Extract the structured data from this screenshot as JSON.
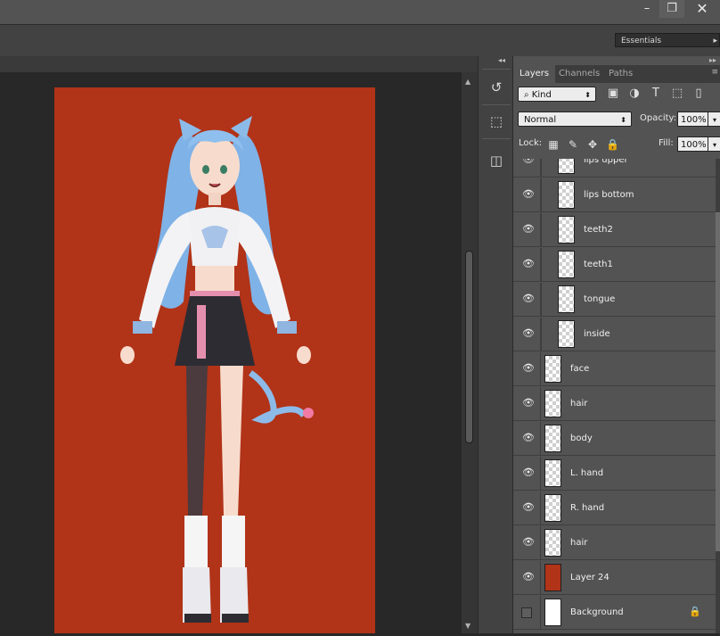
{
  "window": {
    "controls": {
      "minimize": "–",
      "maximize": "❐",
      "close": "✕"
    }
  },
  "options_bar": {
    "workspace": "Essentials",
    "workspace_arrow": "▸"
  },
  "colors": {
    "canvas_background": "#b13318",
    "layer24_swatch": "#b13318"
  },
  "icon_strip": {
    "collapse_glyph": "◂◂",
    "tools": [
      {
        "icon": "history-icon",
        "glyph": "↺"
      },
      {
        "icon": "3d-cube-icon",
        "glyph": "⬚"
      },
      {
        "icon": "layer-comps-icon",
        "glyph": "◫"
      }
    ]
  },
  "layers_panel": {
    "expand_glyph": "▸▸",
    "tabs": [
      {
        "label": "Layers",
        "active": true
      },
      {
        "label": "Channels",
        "active": false
      },
      {
        "label": "Paths",
        "active": false
      }
    ],
    "tab_menu_glyph": "≡",
    "filter": {
      "kind_label": "Kind",
      "search_glyph": "⌕",
      "arrows_glyph": "⬍",
      "icons": [
        {
          "icon": "image-filter-icon",
          "glyph": "▣"
        },
        {
          "icon": "adjustment-filter-icon",
          "glyph": "◑"
        },
        {
          "icon": "type-filter-icon",
          "glyph": "T"
        },
        {
          "icon": "shape-filter-icon",
          "glyph": "⬚"
        },
        {
          "icon": "smart-object-filter-icon",
          "glyph": "▯"
        }
      ]
    },
    "blend": {
      "mode": "Normal",
      "arrows_glyph": "⬍",
      "opacity_label": "Opacity:",
      "opacity_value": "100%",
      "dd_glyph": "▾"
    },
    "lock": {
      "label": "Lock:",
      "icons": [
        {
          "icon": "lock-transparent-pixels-icon",
          "glyph": "▦"
        },
        {
          "icon": "lock-image-pixels-icon",
          "glyph": "✎"
        },
        {
          "icon": "lock-position-icon",
          "glyph": "✥"
        },
        {
          "icon": "lock-all-icon",
          "glyph": "🔒"
        }
      ],
      "fill_label": "Fill:",
      "fill_value": "100%",
      "dd_glyph": "▾"
    },
    "eye_glyph": "👁",
    "layers": [
      {
        "name": "lips upper",
        "visible": true,
        "indented": true,
        "thumb": "checker"
      },
      {
        "name": "lips bottom",
        "visible": true,
        "indented": true,
        "thumb": "checker"
      },
      {
        "name": "teeth2",
        "visible": true,
        "indented": true,
        "thumb": "checker"
      },
      {
        "name": "teeth1",
        "visible": true,
        "indented": true,
        "thumb": "checker"
      },
      {
        "name": "tongue",
        "visible": true,
        "indented": true,
        "thumb": "checker"
      },
      {
        "name": "inside",
        "visible": true,
        "indented": true,
        "thumb": "checker"
      },
      {
        "name": "face",
        "visible": true,
        "indented": false,
        "thumb": "checker"
      },
      {
        "name": "hair",
        "visible": true,
        "indented": false,
        "thumb": "checker"
      },
      {
        "name": "body",
        "visible": true,
        "indented": false,
        "thumb": "checker"
      },
      {
        "name": "L. hand",
        "visible": true,
        "indented": false,
        "thumb": "checker"
      },
      {
        "name": "R. hand",
        "visible": true,
        "indented": false,
        "thumb": "checker"
      },
      {
        "name": "hair",
        "visible": true,
        "indented": false,
        "thumb": "checker"
      },
      {
        "name": "Layer 24",
        "visible": true,
        "indented": false,
        "thumb": "red"
      },
      {
        "name": "Background",
        "visible": false,
        "indented": false,
        "thumb": "white",
        "locked": true,
        "lock_glyph": "🔒"
      }
    ]
  },
  "scrollbar_arrows": {
    "up": "▲",
    "down": "▼"
  }
}
